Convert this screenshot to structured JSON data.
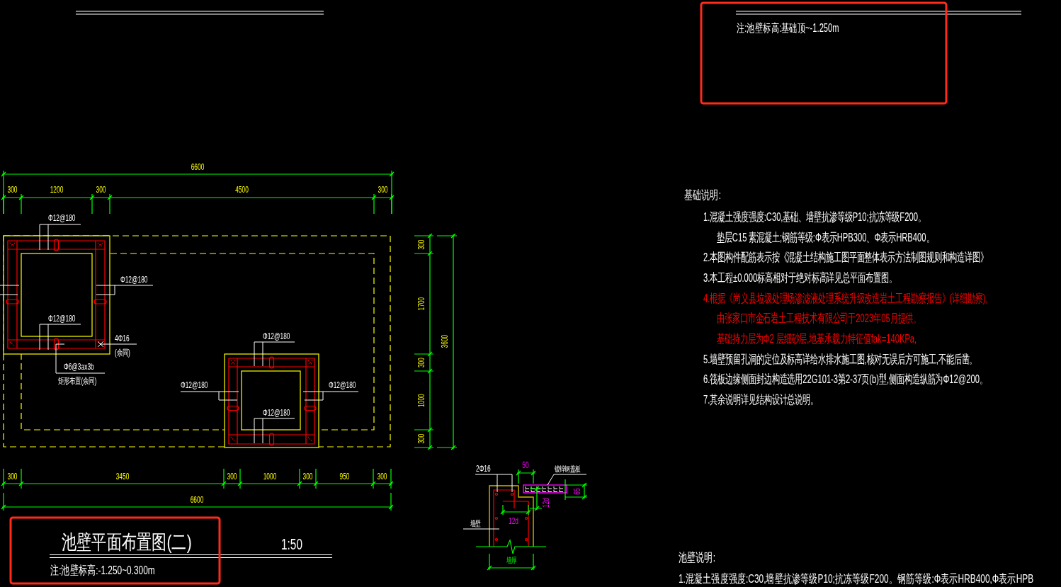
{
  "top_note": {
    "note": "注:池壁标高:基础顶~-1.250m",
    "highlighted": true
  },
  "plan_drawing": {
    "top_overall_dimension": "6600",
    "top_dimensions": [
      "300",
      "1200",
      "300",
      "4500",
      "300"
    ],
    "right_dimensions": [
      "300",
      "1700",
      "300",
      "1000",
      "300"
    ],
    "right_overall_dimension": "3600",
    "bottom_dimensions": [
      "300",
      "3450",
      "300",
      "1000",
      "300",
      "950",
      "300"
    ],
    "bottom_overall_dimension": "6600",
    "rebar_callouts": [
      {
        "lines": [
          "Φ12@180"
        ]
      },
      {
        "lines": [
          "Φ12@180"
        ]
      },
      {
        "lines": [
          "Φ12@180"
        ]
      },
      {
        "lines": [
          "4Φ16",
          "(余同)"
        ]
      },
      {
        "lines": [
          "Φ6@3ax3b",
          "矩形布置(余同)"
        ]
      },
      {
        "lines": [
          "Φ12@180"
        ]
      },
      {
        "lines": [
          "Φ12@180"
        ]
      },
      {
        "lines": [
          "Φ12@180"
        ]
      },
      {
        "lines": [
          "Φ12@180"
        ]
      }
    ]
  },
  "plan_title": {
    "title": "池壁平面布置图(二)",
    "scale": "1:50",
    "note": "注:池壁标高:-1.250~0.300m",
    "highlighted": true
  },
  "section_detail": {
    "rebar_label": "2Φ16",
    "cover_dimension": "50",
    "slab_label": "镀锌钢盖板",
    "slab_thickness_dimension": "65",
    "anchorage_vertical": "12d",
    "anchorage_horizontal": "12d",
    "wall_label": "墙壁",
    "wall_thickness_label": "墙厚"
  },
  "foundation_notes": {
    "heading": "基础说明:",
    "items": [
      {
        "lines": [
          "1.混凝土强度强度:C30,基础、墙壁抗渗等级P10;抗冻等级F200。",
          "垫层C15 素混凝土;钢筋等级:Φ表示HPB300、Φ表示HRB400。"
        ],
        "highlighted": false
      },
      {
        "lines": [
          "2.本图构件配筋表示按《混凝土结构施工图平面整体表示方法制图规则和构造详图》"
        ],
        "highlighted": false
      },
      {
        "lines": [
          "3.本工程±0.000标高相对于绝对标高详见总平面布置图。"
        ],
        "highlighted": false
      },
      {
        "lines": [
          "4.根据《尚义县垃圾处理场渗滤液处理系统升级改造岩土工程勘察报告》(详细勘察),",
          "由张家口市金石岩土工程技术有限公司于2023年05月提供。",
          "基础持力层为Φ2 层细砂层,地基承载力特征值fak=140KPa,"
        ],
        "highlighted": true
      },
      {
        "lines": [
          "5.墙壁预留孔洞的定位及标高详给水排水施工图,核对无误后方可施工,不能后凿。"
        ],
        "highlighted": false
      },
      {
        "lines": [
          "6.筏板边缘侧面封边构造选用22G101-3第2-37页(b)型,侧面构造纵筋为Φ12@200。"
        ],
        "highlighted": false
      },
      {
        "lines": [
          "7.其余说明详见结构设计总说明。"
        ],
        "highlighted": false
      }
    ]
  },
  "wall_notes": {
    "heading": "池壁说明:",
    "lines": [
      "1.混凝土强度强度:C30,墙壁抗渗等级P10;抗冻等级F200。钢筋等级:Φ表示HRB400,Φ表示HPB"
    ]
  }
}
